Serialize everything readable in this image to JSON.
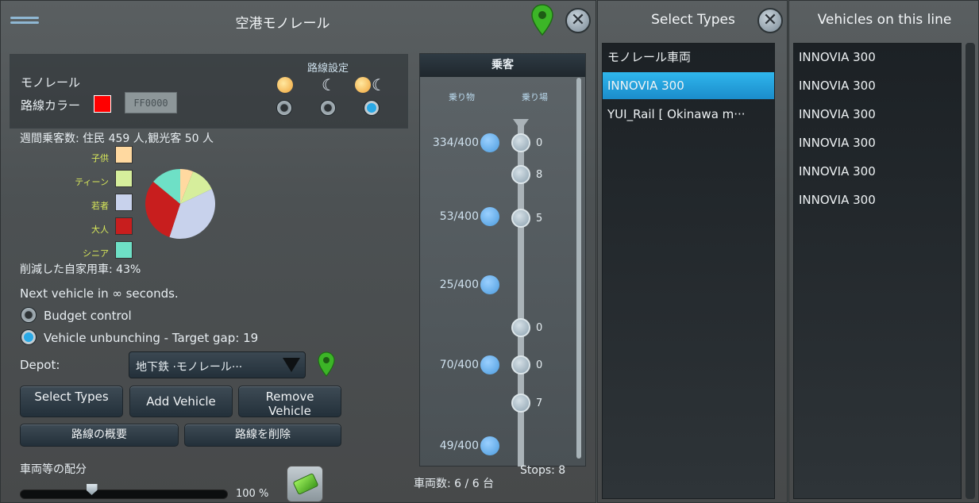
{
  "main_panel": {
    "title": "空港モノレール",
    "line_type": "モノレール",
    "route_settings_label": "路線設定",
    "line_color_label": "路線カラー",
    "line_color_hex": "FF0000",
    "weekly_riders": "週間乗客数: 住民 459 人,観光客 50 人",
    "legend": [
      {
        "label": "子供",
        "color": "#ffd9a0"
      },
      {
        "label": "ティーン",
        "color": "#d6ee9c"
      },
      {
        "label": "若者",
        "color": "#c8d2ec"
      },
      {
        "label": "大人",
        "color": "#c81e1e"
      },
      {
        "label": "シニア",
        "color": "#6ee0c6"
      }
    ],
    "pie_slices": [
      {
        "name": "子供",
        "fraction": 0.06,
        "color": "#ffd9a0"
      },
      {
        "name": "ティーン",
        "fraction": 0.12,
        "color": "#d6ee9c"
      },
      {
        "name": "若者",
        "fraction": 0.37,
        "color": "#c8d2ec"
      },
      {
        "name": "大人",
        "fraction": 0.31,
        "color": "#c81e1e"
      },
      {
        "name": "シニア",
        "fraction": 0.14,
        "color": "#6ee0c6"
      }
    ],
    "reduced_cars": "削減した自家用車: 43%",
    "next_vehicle": "Next vehicle in ∞ seconds.",
    "budget_control": "Budget control",
    "unbunching": "Vehicle unbunching - Target gap: 19",
    "depot_label": "Depot:",
    "depot_value": "地下鉄 ·モノレール···",
    "select_types_btn": "Select Types",
    "add_vehicle_btn": "Add Vehicle",
    "remove_vehicle_btn": "Remove Vehicle",
    "overview_btn": "路線の概要",
    "delete_btn": "路線を削除",
    "allocation_label": "車両等の配分",
    "allocation_percent": "100 %",
    "allocation_fraction": 1.0
  },
  "passenger_panel": {
    "title": "乗客",
    "col_vehicles": "乗り物",
    "col_stops": "乗り場",
    "vehicles": [
      "334/400",
      "53/400",
      "25/400",
      "70/400",
      "49/400"
    ],
    "stops": [
      "0",
      "8",
      "5",
      "0",
      "0",
      "7"
    ],
    "stops_count": "Stops: 8",
    "vehicle_count": "車両数: 6 / 6 台"
  },
  "select_types": {
    "title": "Select Types",
    "items": [
      "モノレール車両",
      "INNOVIA 300",
      "YUI_Rail [ Okinawa m···"
    ],
    "selected_index": 1
  },
  "vehicles_panel": {
    "title": "Vehicles on this line",
    "items": [
      "INNOVIA 300",
      "INNOVIA 300",
      "INNOVIA 300",
      "INNOVIA 300",
      "INNOVIA 300",
      "INNOVIA 300"
    ]
  },
  "colors": {
    "accent": "#2aa9e6",
    "line_red": "#ff0000",
    "pin_green": "#3cb527"
  }
}
